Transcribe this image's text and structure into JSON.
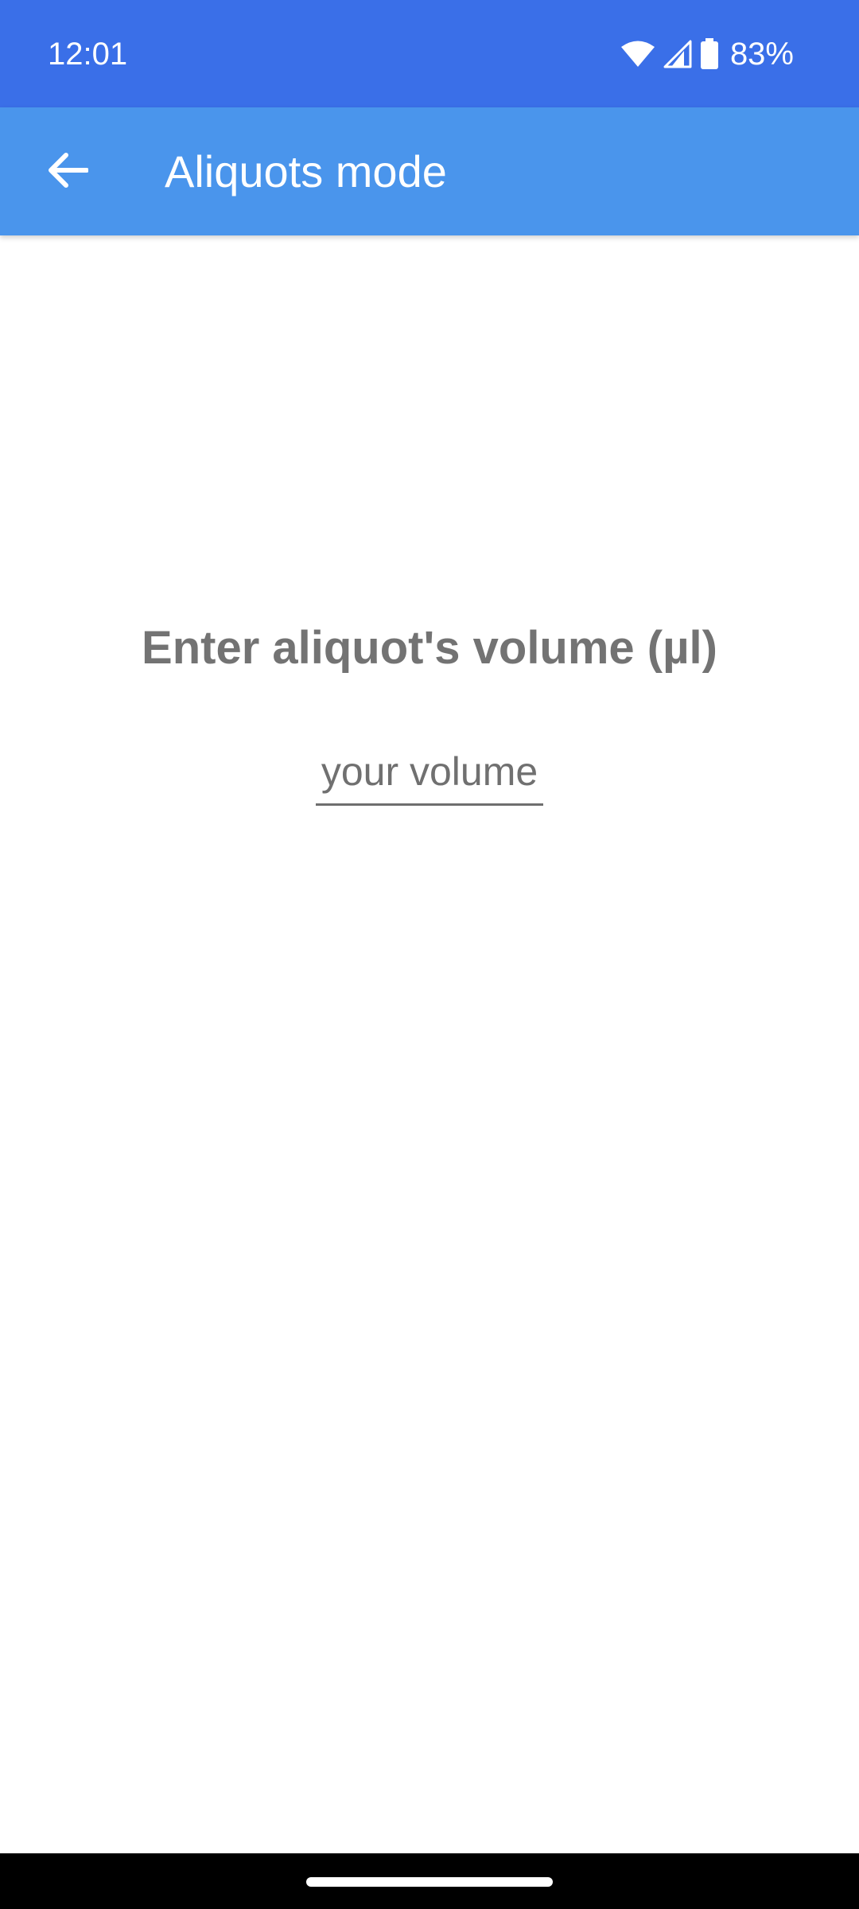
{
  "status_bar": {
    "time": "12:01",
    "battery_percent": "83%",
    "icons": [
      "wifi-icon",
      "cell-signal-icon",
      "battery-icon"
    ],
    "background": "#3a6fe8"
  },
  "app_bar": {
    "title": "Aliquots mode",
    "back_icon": "arrow-back-icon",
    "background": "#4a95ec"
  },
  "main": {
    "prompt": "Enter aliquot's volume (µl)",
    "volume_input": {
      "value": "",
      "placeholder": "your volume"
    }
  }
}
